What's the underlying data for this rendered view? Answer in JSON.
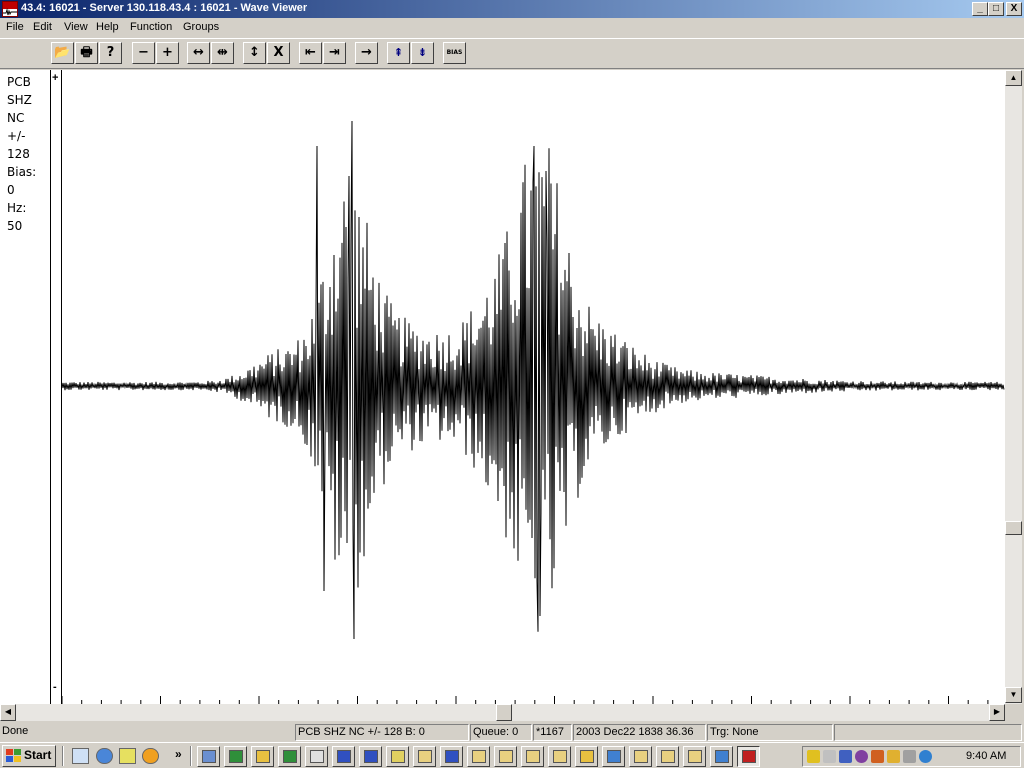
{
  "window": {
    "title": "43.4: 16021 -  Server 130.118.43.4 : 16021 - Wave Viewer",
    "minimize_glyph": "_",
    "maximize_glyph": "□",
    "close_glyph": "X"
  },
  "menu": {
    "items": [
      {
        "label": "File"
      },
      {
        "label": "Edit"
      },
      {
        "label": "View"
      },
      {
        "label": "Help"
      },
      {
        "label": "Function"
      },
      {
        "label": "Groups"
      }
    ]
  },
  "toolbar": {
    "buttons": [
      {
        "icon": "open-folder-icon",
        "glyph": "📂"
      },
      {
        "icon": "print-icon",
        "glyph": "🖶"
      },
      {
        "icon": "help-icon",
        "glyph": "?"
      },
      {
        "icon": "zoom-out-icon",
        "glyph": "−"
      },
      {
        "icon": "zoom-in-icon",
        "glyph": "+"
      },
      {
        "icon": "expand-horizontal-icon",
        "glyph": "↔"
      },
      {
        "icon": "compress-horizontal-icon",
        "glyph": "⇹"
      },
      {
        "icon": "expand-vertical-icon",
        "glyph": "↕"
      },
      {
        "icon": "compress-vertical-icon",
        "glyph": "Ⅹ"
      },
      {
        "icon": "go-start-icon",
        "glyph": "⇤"
      },
      {
        "icon": "go-end-icon",
        "glyph": "⇥"
      },
      {
        "icon": "next-icon",
        "glyph": "→"
      },
      {
        "icon": "scale-up-icon",
        "glyph": "⇞"
      },
      {
        "icon": "scale-down-icon",
        "glyph": "⇟"
      },
      {
        "icon": "bias-icon",
        "glyph": "BIAS"
      }
    ]
  },
  "channel": {
    "lines": [
      "PCB",
      "SHZ",
      "NC",
      "+/-",
      "128",
      "Bias:",
      "0",
      "Hz:",
      "50"
    ]
  },
  "scale": {
    "plus": "+",
    "minus": "-"
  },
  "scroll": {
    "up": "▲",
    "down": "▼",
    "left": "◀",
    "right": "▶"
  },
  "status": {
    "done": "Done",
    "channel": "PCB SHZ NC +/-   128 B:     0",
    "queue": "Queue: 0",
    "count": "*1167",
    "datetime": "2003 Dec22 1838 36.36",
    "trigger": "Trg: None"
  },
  "taskbar": {
    "start_label": "Start",
    "chevron": "»",
    "clock": "9:40 AM"
  },
  "colors": {
    "title_gradient_start": "#0a246a",
    "title_gradient_end": "#a6caf0",
    "trace": "#000000",
    "face": "#d4d0c8"
  }
}
